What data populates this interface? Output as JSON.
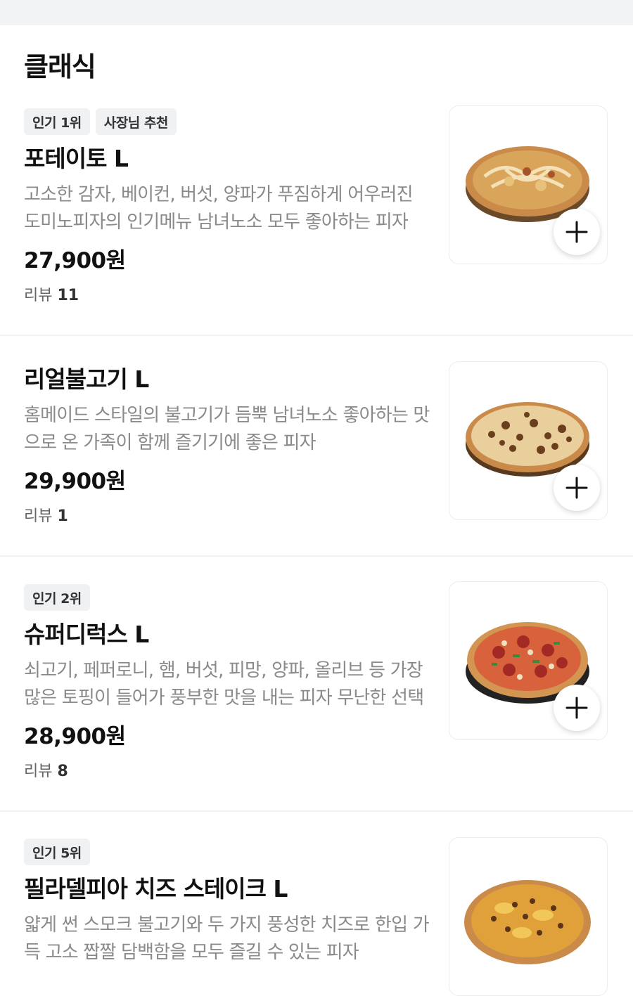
{
  "section": {
    "title": "클래식"
  },
  "items": [
    {
      "badges": [
        "인기 1위",
        "사장님 추천"
      ],
      "name": "포테이토 L",
      "description": "고소한 감자, 베이컨, 버섯, 양파가 푸짐하게 어우러진 도미노피자의 인기메뉴 남녀노소 모두 좋아하는 피자",
      "price": "27,900원",
      "review_label": "리뷰",
      "review_count": "11",
      "image_icon": "potato-pizza-image"
    },
    {
      "badges": [],
      "name": "리얼불고기 L",
      "description": "홈메이드 스타일의  불고기가 듬뿍 남녀노소 좋아하는 맛으로 온 가족이 함께 즐기기에 좋은 피자",
      "price": "29,900원",
      "review_label": "리뷰",
      "review_count": "1",
      "image_icon": "bulgogi-pizza-image"
    },
    {
      "badges": [
        "인기 2위"
      ],
      "name": "슈퍼디럭스 L",
      "description": "쇠고기, 페퍼로니, 햄, 버섯, 피망, 양파, 올리브 등 가장 많은 토핑이 들어가 풍부한 맛을 내는 피자 무난한 선택",
      "price": "28,900원",
      "review_label": "리뷰",
      "review_count": "8",
      "image_icon": "super-deluxe-pizza-image"
    },
    {
      "badges": [
        "인기 5위"
      ],
      "name": "필라델피아 치즈 스테이크 L",
      "description": "얇게 썬 스모크 불고기와 두 가지 풍성한 치즈로 한입 가득 고소 짭짤 담백함을 모두 즐길 수 있는 피자",
      "price": "",
      "review_label": "",
      "review_count": "",
      "image_icon": "philly-cheese-steak-pizza-image"
    }
  ],
  "colors": {
    "badge_bg": "#f0f1f3",
    "desc_text": "#8a8a8a",
    "divider": "#f0f1f3",
    "potato_top": "#d9a55a",
    "bulgogi_top": "#b5773d",
    "deluxe_top": "#c0392b",
    "philly_top": "#e0a13a"
  },
  "icons": {
    "add": "plus-icon"
  }
}
